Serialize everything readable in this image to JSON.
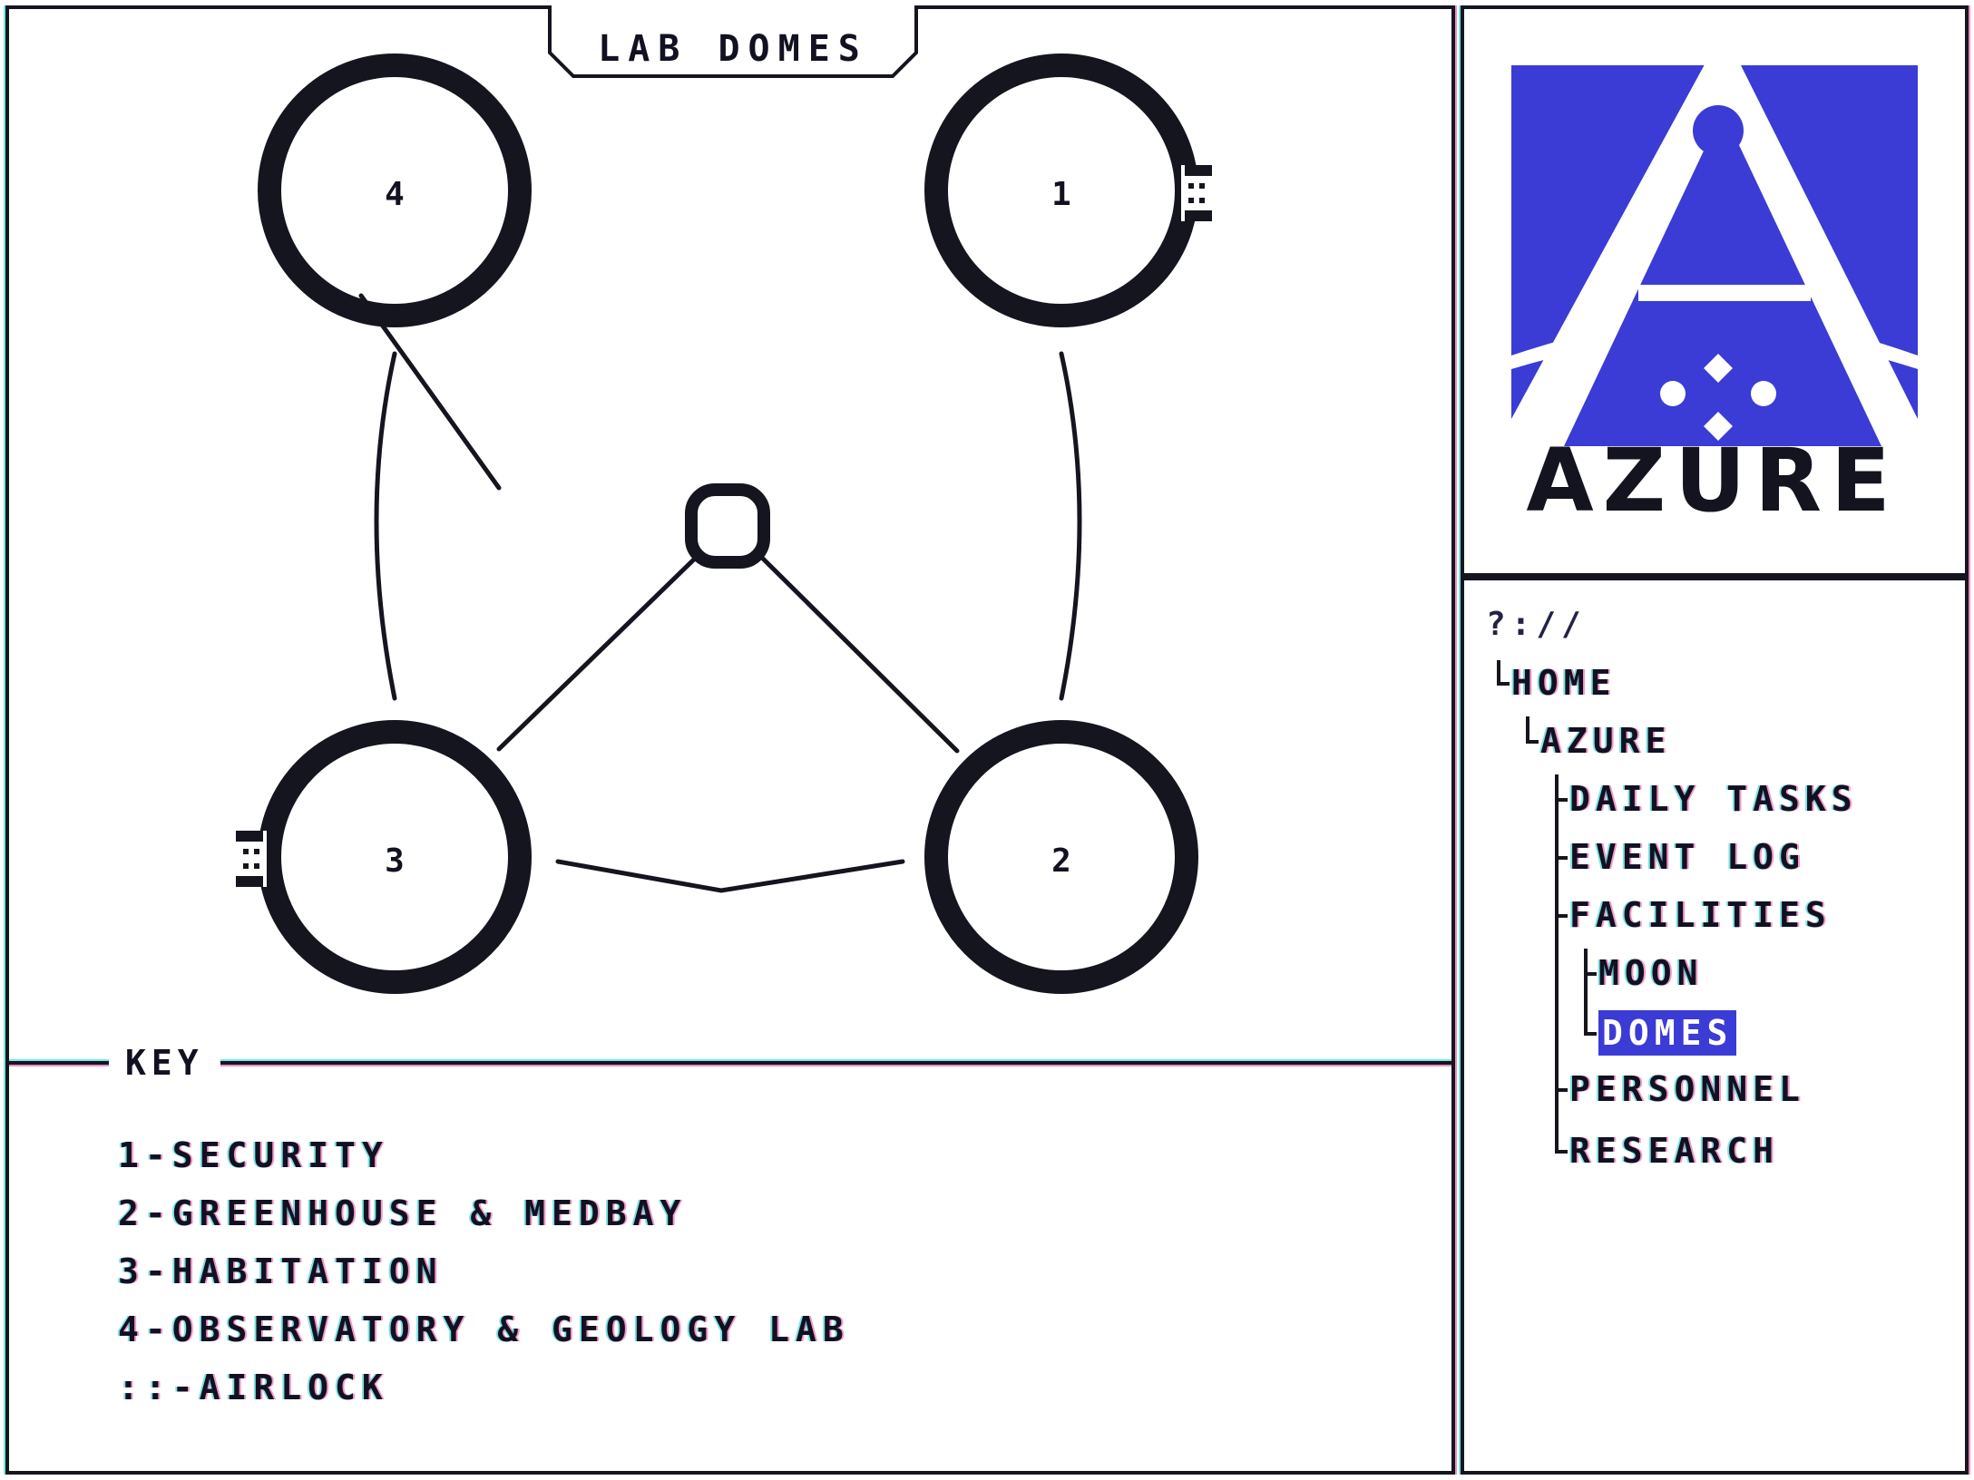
{
  "map": {
    "title": "LAB DOMES",
    "domes": [
      {
        "num": "4"
      },
      {
        "num": "1"
      },
      {
        "num": "3"
      },
      {
        "num": "2"
      }
    ]
  },
  "key": {
    "label": "KEY",
    "items": [
      "1-SECURITY",
      "2-GREENHOUSE & MEDBAY",
      "3-HABITATION",
      "4-OBSERVATORY & GEOLOGY LAB",
      "::-AIRLOCK"
    ]
  },
  "logo": {
    "word": "AZURE",
    "color": "#3b3bd6"
  },
  "nav": {
    "path": "?://",
    "items": [
      {
        "label": "HOME"
      },
      {
        "label": "AZURE"
      },
      {
        "label": "DAILY TASKS"
      },
      {
        "label": "EVENT LOG"
      },
      {
        "label": "FACILITIES"
      },
      {
        "label": "MOON"
      },
      {
        "label": "DOMES",
        "selected": true
      },
      {
        "label": "PERSONNEL"
      },
      {
        "label": "RESEARCH"
      }
    ]
  }
}
